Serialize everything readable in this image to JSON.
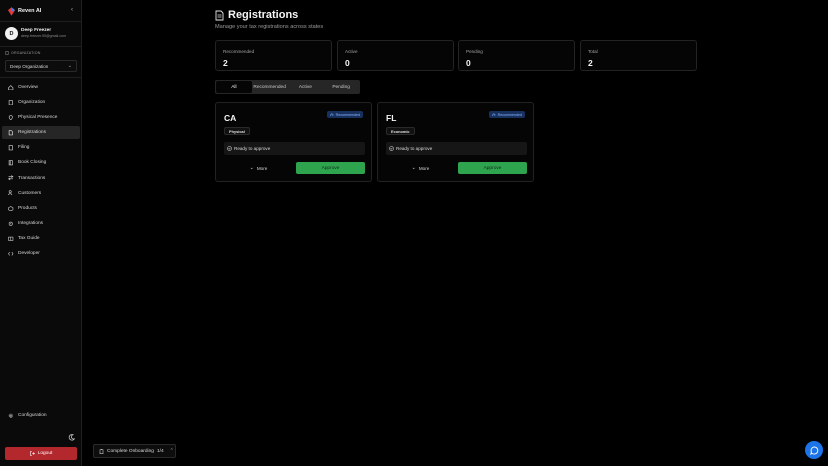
{
  "app": {
    "name": "Reven AI"
  },
  "user": {
    "initial": "D",
    "name": "Deep Freezer",
    "email": "deep.freezer.95@gmail.com"
  },
  "organization": {
    "label": "ORGANIZATION",
    "selected": "Deep Organization"
  },
  "sidebar": {
    "items": [
      {
        "label": "Overview",
        "icon": "home-icon"
      },
      {
        "label": "Organization",
        "icon": "building-icon"
      },
      {
        "label": "Physical Presence",
        "icon": "map-pin-icon"
      },
      {
        "label": "Registrations",
        "icon": "document-icon"
      },
      {
        "label": "Filing",
        "icon": "file-stack-icon"
      },
      {
        "label": "Book Closing",
        "icon": "book-icon"
      },
      {
        "label": "Transactions",
        "icon": "transactions-icon"
      },
      {
        "label": "Customers",
        "icon": "users-icon"
      },
      {
        "label": "Products",
        "icon": "box-icon"
      },
      {
        "label": "Integrations",
        "icon": "plug-icon"
      },
      {
        "label": "Tax Guide",
        "icon": "guide-icon"
      },
      {
        "label": "Developer",
        "icon": "code-icon"
      }
    ],
    "configuration": "Configuration",
    "logout": "Logout"
  },
  "page": {
    "title": "Registrations",
    "subtitle": "Manage your tax registrations across states"
  },
  "stats": [
    {
      "label": "Recommended",
      "value": "2"
    },
    {
      "label": "Active",
      "value": "0"
    },
    {
      "label": "Pending",
      "value": "0"
    },
    {
      "label": "Total",
      "value": "2"
    }
  ],
  "tabs": [
    "All",
    "Recommended",
    "Active",
    "Pending"
  ],
  "cards": [
    {
      "state": "CA",
      "badge": "Recommended",
      "chip": "Physical",
      "status": "Ready to approve",
      "more": "More",
      "approve": "Approve"
    },
    {
      "state": "FL",
      "badge": "Recommended",
      "chip": "Economic",
      "status": "Ready to approve",
      "more": "More",
      "approve": "Approve"
    }
  ],
  "onboarding": {
    "label": "Complete Onboarding",
    "progress": "1/4"
  },
  "colors": {
    "accent": "#1d73e8",
    "approve": "#2fa44f",
    "logout": "#b3282d",
    "badge": "#17305e"
  }
}
